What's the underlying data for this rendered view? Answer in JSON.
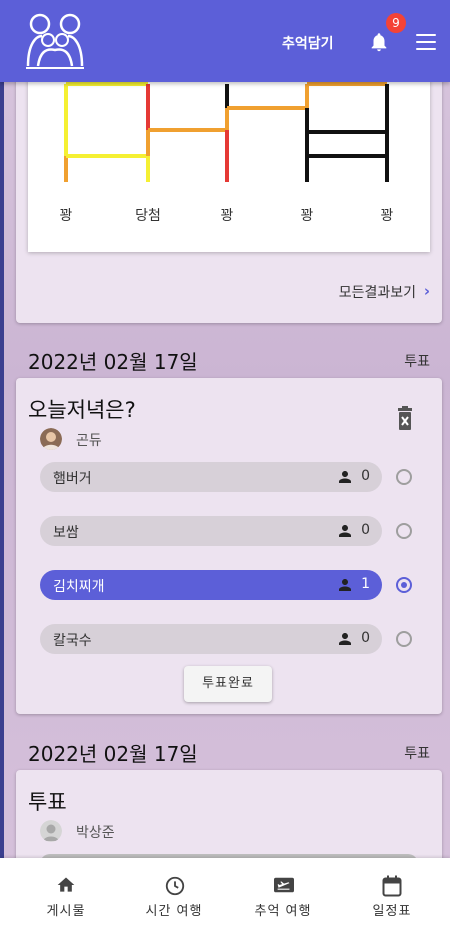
{
  "header": {
    "add_memory_label": "추억담기",
    "notification_count": "9"
  },
  "ladder": {
    "labels": [
      "꽝",
      "당첨",
      "꽝",
      "꽝",
      "꽝"
    ],
    "view_all_label": "모든결과보기",
    "chevron": "›"
  },
  "posts": [
    {
      "date": "2022년 02월 17일",
      "type": "투표",
      "title": "오늘저녁은?",
      "author": "곤듀",
      "options": [
        {
          "label": "햄버거",
          "count": "0",
          "selected": false
        },
        {
          "label": "보쌈",
          "count": "0",
          "selected": false
        },
        {
          "label": "김치찌개",
          "count": "1",
          "selected": true
        },
        {
          "label": "칼국수",
          "count": "0",
          "selected": false
        }
      ],
      "complete_label": "투표완료"
    },
    {
      "date": "2022년 02월 17일",
      "type": "투표",
      "title": "투표",
      "author": "박상준"
    }
  ],
  "bottom_nav": [
    {
      "label": "게시물",
      "icon": "home-icon"
    },
    {
      "label": "시간 여행",
      "icon": "clock-icon"
    },
    {
      "label": "추억 여행",
      "icon": "flight-icon"
    },
    {
      "label": "일정표",
      "icon": "calendar-icon"
    }
  ],
  "colors": {
    "primary": "#5c5fd8",
    "badge": "#f44336",
    "card": "#ede3f0"
  }
}
